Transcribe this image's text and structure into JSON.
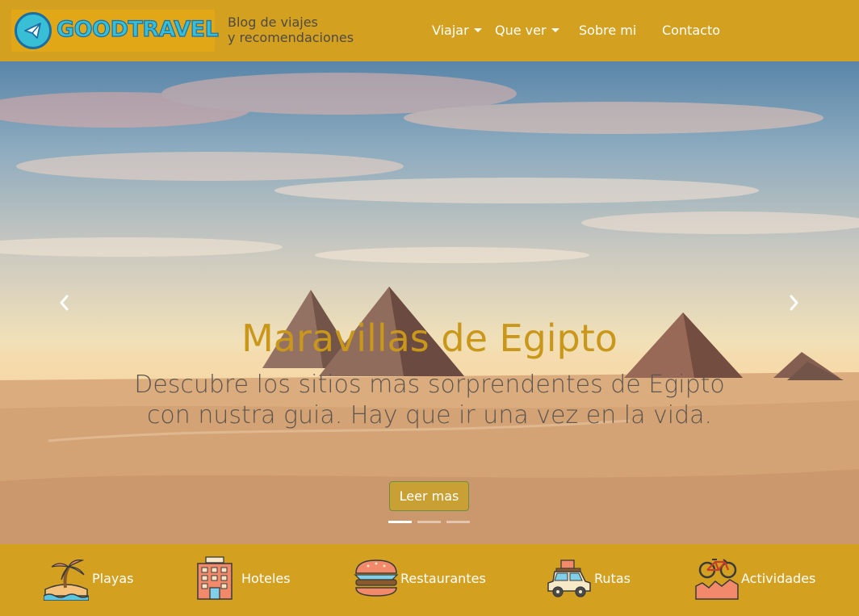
{
  "brand": {
    "name": "GOODTRAVEL",
    "tagline_line1": "Blog de viajes",
    "tagline_line2": "y recomendaciones",
    "accent": "#d4a020",
    "logo_color": "#38bfd6"
  },
  "nav": {
    "items": [
      {
        "label": "Viajar",
        "dropdown": true
      },
      {
        "label": "Que ver",
        "dropdown": true
      },
      {
        "label": "Sobre mi",
        "dropdown": false
      },
      {
        "label": "Contacto",
        "dropdown": false
      }
    ]
  },
  "hero": {
    "title": "Maravillas de Egipto",
    "description": "Descubre los sitios mas sorprendentes de Egipto con nustra guia. Hay que ir una vez en la vida.",
    "button_label": "Leer mas",
    "slide_count": 3,
    "active_slide": 1,
    "prev_icon": "chevron-left-icon",
    "next_icon": "chevron-right-icon"
  },
  "categories": [
    {
      "label": "Playas",
      "icon": "beach-island-icon"
    },
    {
      "label": "Hoteles",
      "icon": "hotel-building-icon"
    },
    {
      "label": "Restaurantes",
      "icon": "burger-icon"
    },
    {
      "label": "Rutas",
      "icon": "car-luggage-icon"
    },
    {
      "label": "Actividades",
      "icon": "bicycle-icon"
    }
  ]
}
